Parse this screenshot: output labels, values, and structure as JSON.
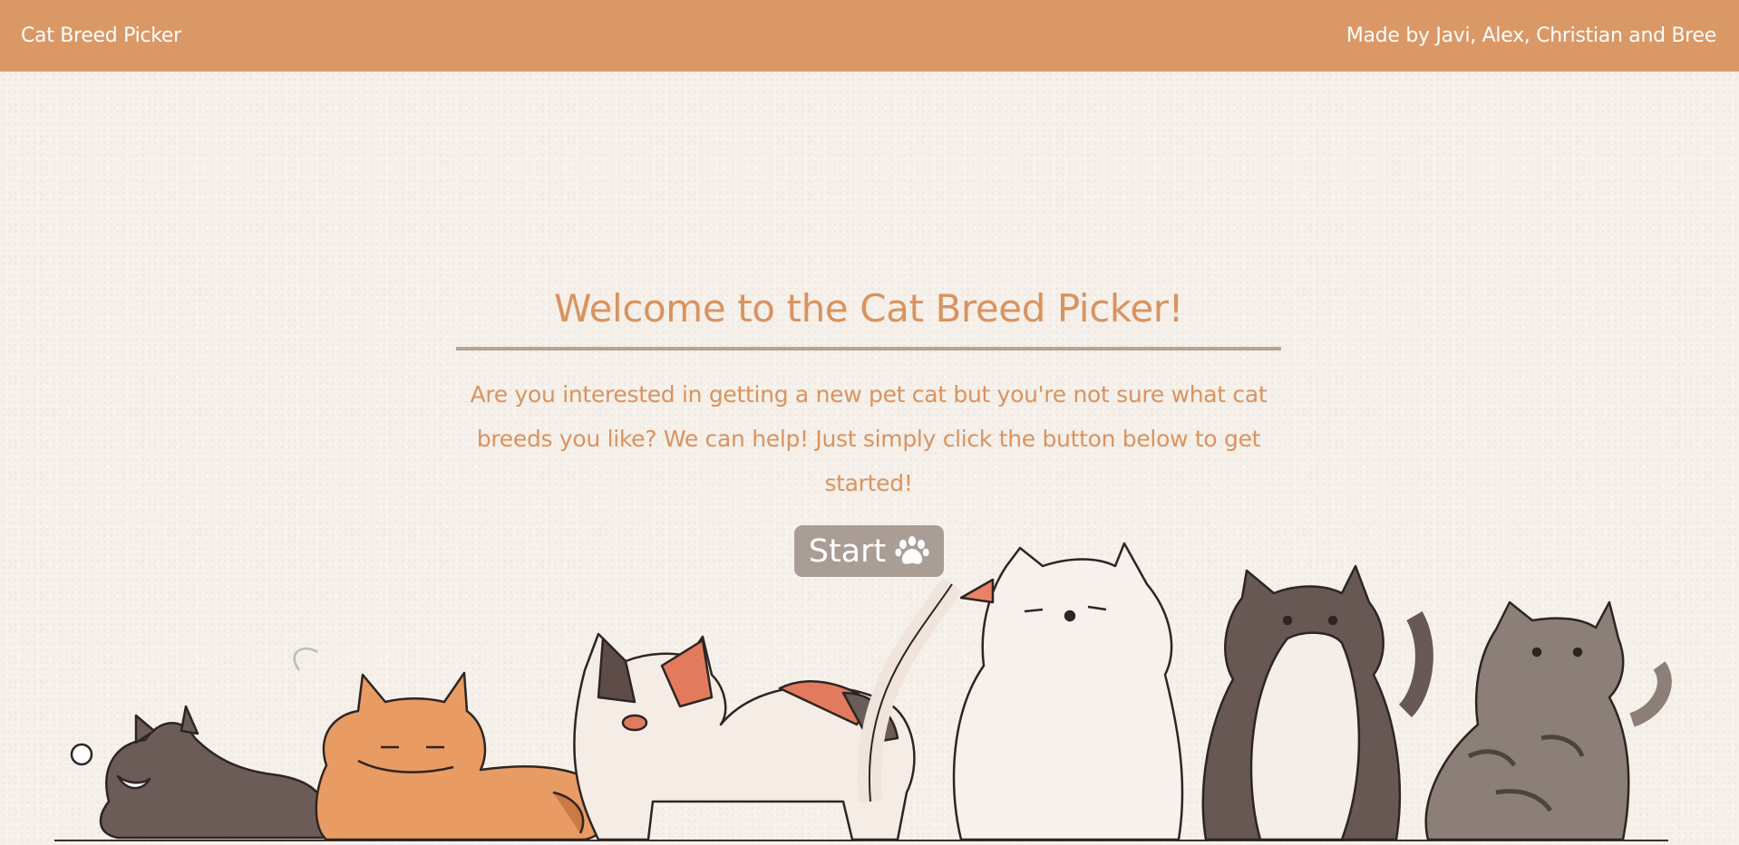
{
  "navbar": {
    "brand": "Cat Breed Picker",
    "credits": "Made by Javi, Alex, Christian and Bree"
  },
  "main": {
    "title": "Welcome to the Cat Breed Picker!",
    "intro": "Are you interested in getting a new pet cat but you're not sure what cat breeds you like? We can help! Just simply click the button below to get started!",
    "start_label": "Start",
    "start_icon": "paw-icon"
  },
  "colors": {
    "navbar": "#da9866",
    "accent_text": "#d9935f",
    "button": "#a99d95",
    "divider": "#b3a296",
    "background": "#f6f0ea"
  },
  "illustration": {
    "description_icon": "cats-illustration"
  }
}
